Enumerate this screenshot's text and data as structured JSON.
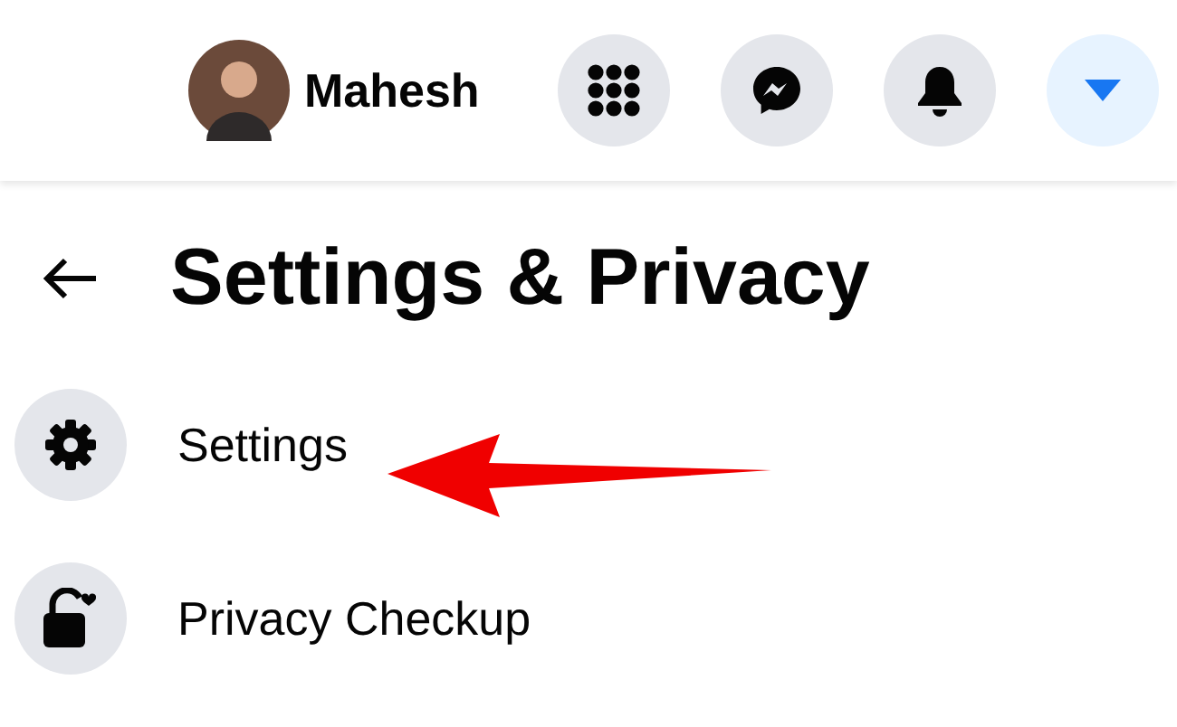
{
  "top_bar": {
    "user_name": "Mahesh",
    "buttons": [
      {
        "kind": "menu",
        "selected": false
      },
      {
        "kind": "messenger",
        "selected": false
      },
      {
        "kind": "notifications",
        "selected": false
      },
      {
        "kind": "account",
        "selected": true
      }
    ]
  },
  "menu": {
    "title": "Settings & Privacy",
    "items": [
      {
        "kind": "settings",
        "label": "Settings"
      },
      {
        "kind": "privacy",
        "label": "Privacy Checkup"
      }
    ]
  }
}
